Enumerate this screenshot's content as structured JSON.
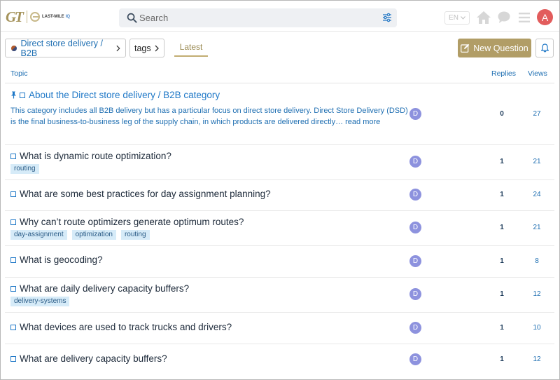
{
  "header": {
    "logo_gt": "GT",
    "logo_text": "LAST-MILE",
    "logo_iq": "IQ",
    "search_placeholder": "Search",
    "language": "EN",
    "avatar_letter": "A"
  },
  "nav": {
    "category_label": "Direct store delivery / B2B",
    "tags_label": "tags",
    "latest_label": "Latest",
    "new_question_label": "New Question"
  },
  "table": {
    "headers": {
      "topic": "Topic",
      "replies": "Replies",
      "views": "Views"
    },
    "rows": [
      {
        "title": "About the Direct store delivery / B2B category",
        "pinned": true,
        "excerpt": "This category includes all B2B delivery but has a particular focus on direct store delivery. Direct Store Delivery (DSD) is the final business-to-business leg of the supply chain, in which products are delivered directly… read more",
        "poster": "D",
        "replies": "0",
        "views": "27",
        "tags": []
      },
      {
        "title": "What is dynamic route optimization?",
        "poster": "D",
        "replies": "1",
        "views": "21",
        "tags": [
          "routing"
        ]
      },
      {
        "title": "What are some best practices for day assignment planning?",
        "poster": "D",
        "replies": "1",
        "views": "24",
        "tags": []
      },
      {
        "title": "Why can’t route optimizers generate optimum routes?",
        "poster": "D",
        "replies": "1",
        "views": "21",
        "tags": [
          "day-assignment",
          "optimization",
          "routing"
        ]
      },
      {
        "title": "What is geocoding?",
        "poster": "D",
        "replies": "1",
        "views": "8",
        "tags": []
      },
      {
        "title": "What are daily delivery capacity buffers?",
        "poster": "D",
        "replies": "1",
        "views": "12",
        "tags": [
          "delivery-systems"
        ]
      },
      {
        "title": "What devices are used to track trucks and drivers?",
        "poster": "D",
        "replies": "1",
        "views": "10",
        "tags": []
      },
      {
        "title": "What are delivery capacity buffers?",
        "poster": "D",
        "replies": "1",
        "views": "12",
        "tags": []
      }
    ]
  },
  "colors": {
    "accent_gold": "#b19d66",
    "link_blue": "#1f78c7",
    "tag_bg": "#d6ebf8",
    "avatar_red": "#e25c5c",
    "poster_purple": "#8d92de"
  },
  "icons": {
    "search": "search-icon",
    "filter": "sliders-icon",
    "home": "home-icon",
    "chat": "chat-bubble-icon",
    "menu": "hamburger-icon",
    "bell": "bell-icon",
    "pencil": "pencil-square-icon",
    "pin": "pin-icon"
  }
}
